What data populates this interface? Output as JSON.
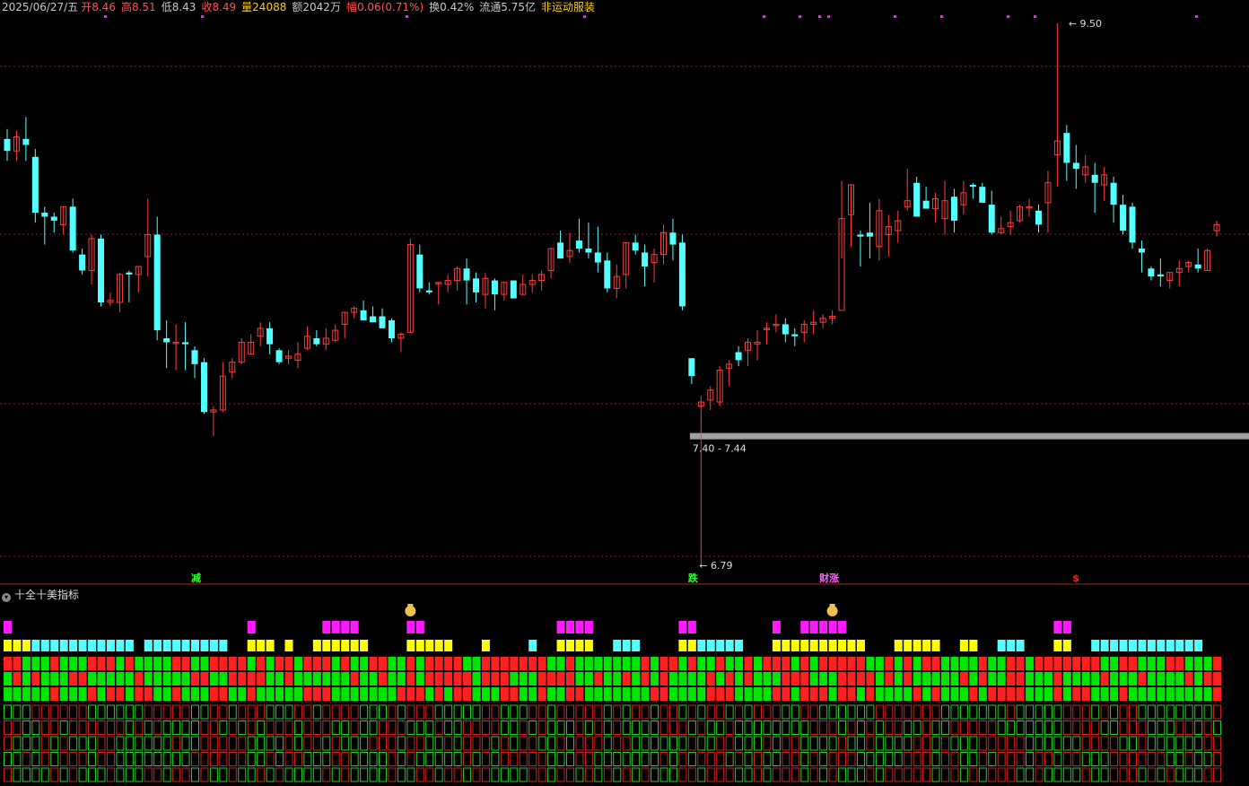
{
  "header": {
    "date": "2025/06/27/五",
    "open_label": "开",
    "open": "8.46",
    "high_label": "高",
    "high": "8.51",
    "low_label": "低",
    "low": "8.43",
    "close_label": "收",
    "close": "8.49",
    "vol_label": "量",
    "vol": "24088",
    "amt_label": "额",
    "amt": "2042万",
    "chg_label": "幅",
    "chg": "0.06(0.71%)",
    "turn_label": "换",
    "turn": "0.42%",
    "float_label": "流通",
    "float": "5.75亿",
    "sector": "非运动服装"
  },
  "indicator": {
    "title": "十全十美指标",
    "toggle_icon": "chevron-down-icon"
  },
  "colors": {
    "up": "#ff3c3c",
    "down": "#54ffff",
    "bg": "#000000",
    "magenta": "#ff19ff",
    "yellow": "#ffff00",
    "green": "#00e600",
    "grid": "#8c1e1e",
    "zone": "#a0a0a0"
  },
  "chart_data": {
    "type": "candlestick",
    "title": "",
    "y_range": [
      6.79,
      9.5
    ],
    "annotations": {
      "high_marker": "9.50",
      "low_marker": "6.79",
      "zone_label": "7.40 - 7.44",
      "zone_range": [
        7.4,
        7.44
      ],
      "signals": [
        {
          "index": 20,
          "text": "减"
        },
        {
          "index": 73,
          "text": "跌"
        },
        {
          "index": 87,
          "text": "财涨"
        },
        {
          "index": 114,
          "text": "$"
        }
      ],
      "money_bag_indices": [
        43,
        88
      ]
    },
    "candles": [
      [
        8.92,
        8.97,
        8.81,
        8.86
      ],
      [
        8.86,
        8.96,
        8.81,
        8.93
      ],
      [
        8.92,
        9.03,
        8.81,
        8.89
      ],
      [
        8.83,
        8.87,
        8.5,
        8.55
      ],
      [
        8.55,
        8.58,
        8.39,
        8.53
      ],
      [
        8.53,
        8.55,
        8.45,
        8.51
      ],
      [
        8.49,
        8.58,
        8.44,
        8.58
      ],
      [
        8.58,
        8.62,
        8.35,
        8.36
      ],
      [
        8.34,
        8.37,
        8.24,
        8.26
      ],
      [
        8.26,
        8.44,
        8.19,
        8.42
      ],
      [
        8.42,
        8.44,
        8.08,
        8.1
      ],
      [
        8.1,
        8.15,
        8.08,
        8.11
      ],
      [
        8.1,
        8.25,
        8.05,
        8.24
      ],
      [
        8.25,
        8.26,
        8.1,
        8.24
      ],
      [
        8.24,
        8.28,
        8.15,
        8.28
      ],
      [
        8.33,
        8.62,
        8.23,
        8.44
      ],
      [
        8.44,
        8.53,
        7.91,
        7.96
      ],
      [
        7.92,
        8.01,
        7.77,
        7.9
      ],
      [
        7.9,
        7.99,
        7.76,
        7.9
      ],
      [
        7.9,
        8.0,
        7.76,
        7.89
      ],
      [
        7.86,
        7.88,
        7.72,
        7.79
      ],
      [
        7.8,
        7.82,
        7.54,
        7.55
      ],
      [
        7.55,
        7.58,
        7.43,
        7.56
      ],
      [
        7.56,
        7.8,
        7.55,
        7.73
      ],
      [
        7.75,
        7.82,
        7.72,
        7.8
      ],
      [
        7.8,
        7.92,
        7.79,
        7.9
      ],
      [
        7.84,
        7.94,
        7.84,
        7.9
      ],
      [
        7.93,
        8.0,
        7.88,
        7.97
      ],
      [
        7.97,
        8.0,
        7.84,
        7.89
      ],
      [
        7.86,
        7.87,
        7.79,
        7.8
      ],
      [
        7.82,
        7.86,
        7.79,
        7.83
      ],
      [
        7.81,
        7.9,
        7.77,
        7.84
      ],
      [
        7.87,
        7.98,
        7.86,
        7.93
      ],
      [
        7.92,
        7.96,
        7.88,
        7.89
      ],
      [
        7.89,
        7.97,
        7.86,
        7.92
      ],
      [
        7.91,
        7.99,
        7.9,
        7.96
      ],
      [
        7.99,
        8.05,
        7.92,
        8.05
      ],
      [
        8.05,
        8.08,
        8.02,
        8.07
      ],
      [
        8.06,
        8.11,
        8.02,
        8.01
      ],
      [
        8.03,
        8.08,
        8.0,
        8.0
      ],
      [
        8.03,
        8.07,
        8.01,
        7.97
      ],
      [
        8.01,
        8.02,
        7.9,
        7.92
      ],
      [
        7.92,
        7.95,
        7.85,
        7.94
      ],
      [
        7.95,
        8.42,
        7.95,
        8.39
      ],
      [
        8.34,
        8.39,
        8.15,
        8.17
      ],
      [
        8.16,
        8.2,
        8.14,
        8.15
      ],
      [
        8.2,
        8.2,
        8.09,
        8.2
      ],
      [
        8.19,
        8.24,
        8.15,
        8.21
      ],
      [
        8.21,
        8.28,
        8.16,
        8.27
      ],
      [
        8.27,
        8.32,
        8.09,
        8.21
      ],
      [
        8.22,
        8.25,
        8.1,
        8.15
      ],
      [
        8.14,
        8.25,
        8.07,
        8.22
      ],
      [
        8.21,
        8.22,
        8.06,
        8.14
      ],
      [
        8.14,
        8.2,
        8.11,
        8.2
      ],
      [
        8.21,
        8.21,
        8.12,
        8.12
      ],
      [
        8.14,
        8.24,
        8.14,
        8.19
      ],
      [
        8.19,
        8.24,
        8.15,
        8.21
      ],
      [
        8.21,
        8.26,
        8.16,
        8.24
      ],
      [
        8.26,
        8.37,
        8.22,
        8.37
      ],
      [
        8.4,
        8.46,
        8.36,
        8.32
      ],
      [
        8.33,
        8.45,
        8.3,
        8.36
      ],
      [
        8.41,
        8.52,
        8.35,
        8.37
      ],
      [
        8.37,
        8.5,
        8.32,
        8.35
      ],
      [
        8.35,
        8.48,
        8.25,
        8.3
      ],
      [
        8.31,
        8.35,
        8.15,
        8.17
      ],
      [
        8.17,
        8.29,
        8.12,
        8.23
      ],
      [
        8.24,
        8.4,
        8.17,
        8.4
      ],
      [
        8.4,
        8.44,
        8.34,
        8.36
      ],
      [
        8.35,
        8.39,
        8.18,
        8.28
      ],
      [
        8.3,
        8.37,
        8.2,
        8.34
      ],
      [
        8.34,
        8.49,
        8.29,
        8.45
      ],
      [
        8.45,
        8.52,
        8.31,
        8.39
      ],
      [
        8.4,
        8.44,
        8.06,
        8.08
      ],
      [
        7.82,
        7.82,
        7.69,
        7.73
      ],
      [
        7.58,
        7.63,
        6.79,
        7.6
      ],
      [
        7.61,
        7.68,
        7.56,
        7.66
      ],
      [
        7.6,
        7.78,
        7.58,
        7.76
      ],
      [
        7.77,
        7.81,
        7.68,
        7.79
      ],
      [
        7.85,
        7.88,
        7.78,
        7.81
      ],
      [
        7.86,
        7.92,
        7.78,
        7.9
      ],
      [
        7.89,
        7.96,
        7.81,
        7.9
      ],
      [
        7.97,
        8.0,
        7.89,
        7.97
      ],
      [
        7.99,
        8.04,
        7.95,
        7.99
      ],
      [
        7.99,
        8.02,
        7.9,
        7.94
      ],
      [
        7.94,
        7.97,
        7.88,
        7.93
      ],
      [
        7.95,
        8.01,
        7.9,
        7.99
      ],
      [
        7.99,
        8.06,
        7.94,
        8.0
      ],
      [
        8.0,
        8.04,
        7.97,
        8.02
      ],
      [
        8.02,
        8.06,
        7.99,
        8.03
      ],
      [
        8.06,
        8.71,
        8.32,
        8.52
      ],
      [
        8.54,
        8.69,
        8.38,
        8.69
      ],
      [
        8.44,
        8.46,
        8.28,
        8.43
      ],
      [
        8.45,
        8.6,
        8.32,
        8.43
      ],
      [
        8.38,
        8.62,
        8.31,
        8.56
      ],
      [
        8.44,
        8.54,
        8.33,
        8.48
      ],
      [
        8.46,
        8.56,
        8.4,
        8.51
      ],
      [
        8.58,
        8.77,
        8.56,
        8.61
      ],
      [
        8.7,
        8.73,
        8.59,
        8.53
      ],
      [
        8.61,
        8.68,
        8.58,
        8.57
      ],
      [
        8.57,
        8.65,
        8.5,
        8.62
      ],
      [
        8.52,
        8.71,
        8.44,
        8.61
      ],
      [
        8.63,
        8.67,
        8.45,
        8.51
      ],
      [
        8.59,
        8.71,
        8.54,
        8.65
      ],
      [
        8.69,
        8.7,
        8.62,
        8.68
      ],
      [
        8.68,
        8.7,
        8.61,
        8.6
      ],
      [
        8.59,
        8.66,
        8.44,
        8.45
      ],
      [
        8.45,
        8.53,
        8.44,
        8.47
      ],
      [
        8.48,
        8.56,
        8.44,
        8.5
      ],
      [
        8.51,
        8.59,
        8.5,
        8.58
      ],
      [
        8.58,
        8.62,
        8.53,
        8.58
      ],
      [
        8.56,
        8.59,
        8.45,
        8.49
      ],
      [
        8.6,
        8.76,
        8.45,
        8.7
      ],
      [
        8.84,
        9.5,
        8.68,
        8.91
      ],
      [
        8.95,
        8.99,
        8.71,
        8.8
      ],
      [
        8.8,
        8.89,
        8.67,
        8.77
      ],
      [
        8.74,
        8.84,
        8.7,
        8.78
      ],
      [
        8.74,
        8.8,
        8.55,
        8.7
      ],
      [
        8.69,
        8.78,
        8.61,
        8.74
      ],
      [
        8.7,
        8.73,
        8.5,
        8.59
      ],
      [
        8.59,
        8.64,
        8.44,
        8.46
      ],
      [
        8.58,
        8.6,
        8.37,
        8.4
      ],
      [
        8.37,
        8.41,
        8.25,
        8.35
      ],
      [
        8.27,
        8.28,
        8.21,
        8.23
      ],
      [
        8.24,
        8.32,
        8.18,
        8.23
      ],
      [
        8.21,
        8.25,
        8.17,
        8.25
      ],
      [
        8.25,
        8.31,
        8.18,
        8.27
      ],
      [
        8.28,
        8.31,
        8.25,
        8.3
      ],
      [
        8.29,
        8.37,
        8.25,
        8.27
      ],
      [
        8.26,
        8.37,
        8.26,
        8.36
      ],
      [
        8.46,
        8.51,
        8.43,
        8.49
      ]
    ]
  }
}
